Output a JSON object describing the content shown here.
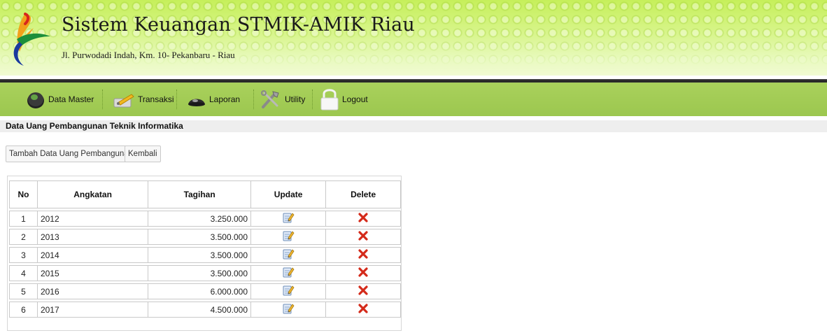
{
  "header": {
    "title": "Sistem Keuangan STMIK-AMIK Riau",
    "address": "Jl. Purwodadi Indah, Km. 10- Pekanbaru - Riau",
    "logo_icon": "stmik-amik-logo"
  },
  "menu": {
    "items": [
      {
        "label": "Data Master",
        "icon": "database-icon"
      },
      {
        "label": "Transaksi",
        "icon": "transaction-icon"
      },
      {
        "label": "Laporan",
        "icon": "report-icon"
      },
      {
        "label": "Utility",
        "icon": "tools-icon"
      },
      {
        "label": "Logout",
        "icon": "lock-icon"
      }
    ]
  },
  "page": {
    "section_title": "Data Uang Pembangunan Teknik Informatika",
    "add_button": "Tambah Data Uang Pembangunan",
    "back_button": "Kembali"
  },
  "table": {
    "columns": [
      "No",
      "Angkatan",
      "Tagihan",
      "Update",
      "Delete"
    ],
    "rows": [
      {
        "no": "1",
        "angkatan": "2012",
        "tagihan": "3.250.000"
      },
      {
        "no": "2",
        "angkatan": "2013",
        "tagihan": "3.500.000"
      },
      {
        "no": "3",
        "angkatan": "2014",
        "tagihan": "3.500.000"
      },
      {
        "no": "4",
        "angkatan": "2015",
        "tagihan": "3.500.000"
      },
      {
        "no": "5",
        "angkatan": "2016",
        "tagihan": "6.000.000"
      },
      {
        "no": "6",
        "angkatan": "2017",
        "tagihan": "4.500.000"
      }
    ],
    "update_icon": "edit-icon",
    "delete_icon": "delete-x-icon"
  },
  "colors": {
    "header_green": "#c6ef5a",
    "menu_green": "#a2cc55",
    "delete_red": "#d42a1a",
    "section_bg": "#eeeeee"
  }
}
